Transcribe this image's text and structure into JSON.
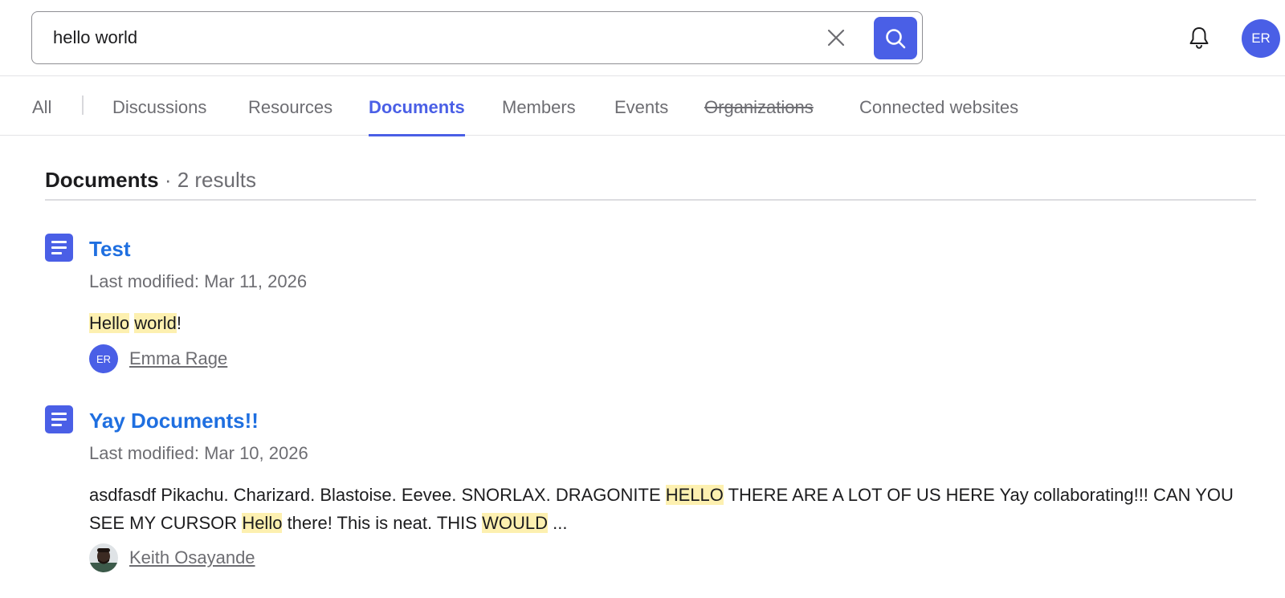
{
  "search": {
    "value": "hello world"
  },
  "user": {
    "initials": "ER"
  },
  "tabs": [
    {
      "label": "All"
    },
    {
      "label": "Discussions"
    },
    {
      "label": "Resources"
    },
    {
      "label": "Documents",
      "active": true
    },
    {
      "label": "Members"
    },
    {
      "label": "Events"
    },
    {
      "label": "Organizations",
      "struck": true
    },
    {
      "label": "Connected websites"
    }
  ],
  "section": {
    "title": "Documents",
    "count": "· 2 results"
  },
  "results": [
    {
      "title": "Test",
      "modified": "Last modified: Mar 11, 2026",
      "snippet": [
        "Hello",
        " ",
        "world",
        "!"
      ],
      "author": {
        "name": "Emma Rage",
        "initials": "ER"
      }
    },
    {
      "title": "Yay Documents!!",
      "modified": "Last modified: Mar 10, 2026",
      "snippet": [
        "asdfasdf Pikachu. Charizard. Blastoise. Eevee. SNORLAX. DRAGONITE ",
        "HELLO",
        " THERE ARE A LOT OF US HERE Yay collaborating!!! CAN YOU SEE MY CURSOR ",
        "Hello",
        " there! This is neat. THIS ",
        "WOULD",
        " ..."
      ],
      "author": {
        "name": "Keith Osayande"
      }
    }
  ],
  "colors": {
    "accent": "#4a5fe6",
    "link": "#1f6fe0",
    "highlight": "#fdf0b0",
    "muted": "#6d6d72"
  },
  "icons": [
    "close-icon",
    "search-icon",
    "bell-icon",
    "document-icon"
  ]
}
